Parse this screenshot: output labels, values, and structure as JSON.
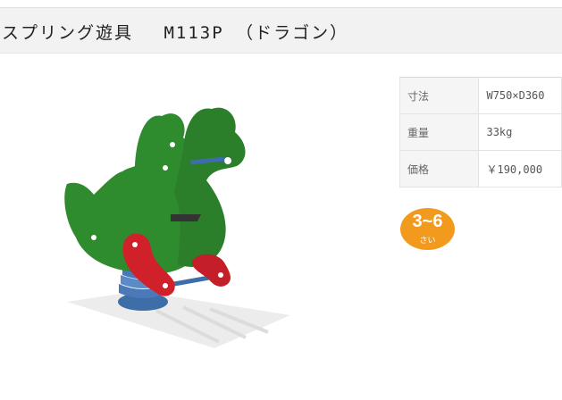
{
  "header": {
    "title": "スプリング遊具　 M113P （ドラゴン）"
  },
  "specs": [
    {
      "label": "寸法",
      "value": "W750×D360"
    },
    {
      "label": "重量",
      "value": "33kg"
    },
    {
      "label": "価格",
      "value": "￥190,000"
    }
  ],
  "age_badge": {
    "range": "3~6",
    "unit": "さい"
  },
  "product_image": {
    "icon": "dragon-spring-rider-icon"
  },
  "colors": {
    "dragon_green": "#2e8b2e",
    "accent_red": "#d0202a",
    "spring_blue": "#4a78b8",
    "badge_orange": "#f29a1e"
  }
}
